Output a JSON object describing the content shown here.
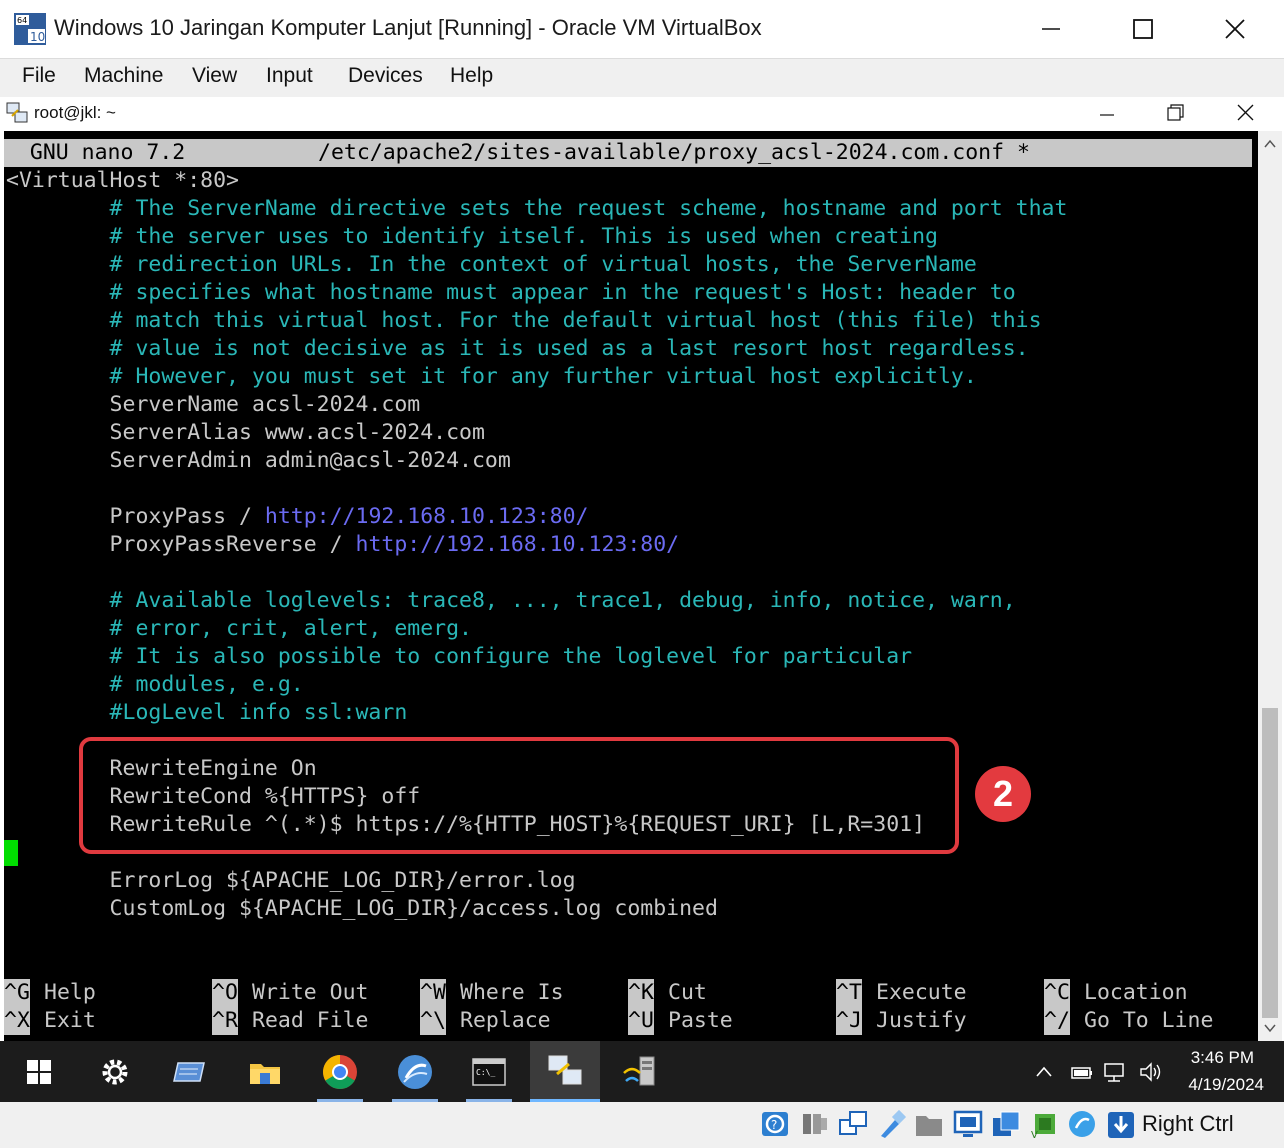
{
  "vbox": {
    "title": "Windows 10 Jaringan Komputer Lanjut [Running] - Oracle VM VirtualBox",
    "app_icon_badge_top": "64",
    "app_icon_badge": "10",
    "menu": [
      "File",
      "Machine",
      "View",
      "Input",
      "Devices",
      "Help"
    ],
    "host_key": "Right Ctrl"
  },
  "putty": {
    "title": "root@jkl: ~"
  },
  "nano": {
    "version": "  GNU nano 7.2",
    "filename": "/etc/apache2/sites-available/proxy_acsl-2024.com.conf *",
    "lines": [
      {
        "t": "<VirtualHost *:80>",
        "c": "key"
      },
      {
        "t": "        # The ServerName directive sets the request scheme, hostname and port that",
        "c": "comment"
      },
      {
        "t": "        # the server uses to identify itself. This is used when creating",
        "c": "comment"
      },
      {
        "t": "        # redirection URLs. In the context of virtual hosts, the ServerName",
        "c": "comment"
      },
      {
        "t": "        # specifies what hostname must appear in the request's Host: header to",
        "c": "comment"
      },
      {
        "t": "        # match this virtual host. For the default virtual host (this file) this",
        "c": "comment"
      },
      {
        "t": "        # value is not decisive as it is used as a last resort host regardless.",
        "c": "comment"
      },
      {
        "t": "        # However, you must set it for any further virtual host explicitly.",
        "c": "comment"
      },
      {
        "t": "        ServerName acsl-2024.com",
        "c": "key"
      },
      {
        "t": "        ServerAlias www.acsl-2024.com",
        "c": "key"
      },
      {
        "t": "        ServerAdmin admin@acsl-2024.com",
        "c": "key"
      },
      {
        "t": "",
        "c": "key"
      },
      {
        "t": "        ProxyPass / ",
        "c": "key",
        "url": "http://192.168.10.123:80/"
      },
      {
        "t": "        ProxyPassReverse / ",
        "c": "key",
        "url": "http://192.168.10.123:80/"
      },
      {
        "t": "",
        "c": "key"
      },
      {
        "t": "        # Available loglevels: trace8, ..., trace1, debug, info, notice, warn,",
        "c": "comment"
      },
      {
        "t": "        # error, crit, alert, emerg.",
        "c": "comment"
      },
      {
        "t": "        # It is also possible to configure the loglevel for particular",
        "c": "comment"
      },
      {
        "t": "        # modules, e.g.",
        "c": "comment"
      },
      {
        "t": "        #LogLevel info ssl:warn",
        "c": "comment"
      },
      {
        "t": "",
        "c": "key"
      },
      {
        "t": "        RewriteEngine On",
        "c": "key"
      },
      {
        "t": "        RewriteCond %{HTTPS} off",
        "c": "key"
      },
      {
        "t": "        RewriteRule ^(.*)$ https://%{HTTP_HOST}%{REQUEST_URI} [L,R=301]",
        "c": "key"
      },
      {
        "t": "",
        "c": "key"
      },
      {
        "t": "        ErrorLog ${APACHE_LOG_DIR}/error.log",
        "c": "key"
      },
      {
        "t": "        CustomLog ${APACHE_LOG_DIR}/access.log combined",
        "c": "key"
      }
    ],
    "shortcuts": [
      {
        "key": "^G",
        "label": "Help"
      },
      {
        "key": "^O",
        "label": "Write Out"
      },
      {
        "key": "^W",
        "label": "Where Is"
      },
      {
        "key": "^K",
        "label": "Cut"
      },
      {
        "key": "^T",
        "label": "Execute"
      },
      {
        "key": "^C",
        "label": "Location"
      },
      {
        "key": "^X",
        "label": "Exit"
      },
      {
        "key": "^R",
        "label": "Read File"
      },
      {
        "key": "^\\",
        "label": "Replace"
      },
      {
        "key": "^U",
        "label": "Paste"
      },
      {
        "key": "^J",
        "label": "Justify"
      },
      {
        "key": "^/",
        "label": "Go To Line"
      }
    ]
  },
  "annotation": {
    "badge": "2"
  },
  "taskbar": {
    "time": "3:46 PM",
    "date": "4/19/2024",
    "apps": [
      "start-icon",
      "settings-icon",
      "vmware-icon",
      "file-explorer-icon",
      "chrome-icon",
      "fedora-icon",
      "cmd-icon",
      "putty-icon",
      "network-tool-icon"
    ]
  },
  "colors": {
    "comment": "#2ab7b7",
    "url": "#6b6bf2",
    "highlight": "#e03a3f",
    "cursor": "#00dd00"
  }
}
